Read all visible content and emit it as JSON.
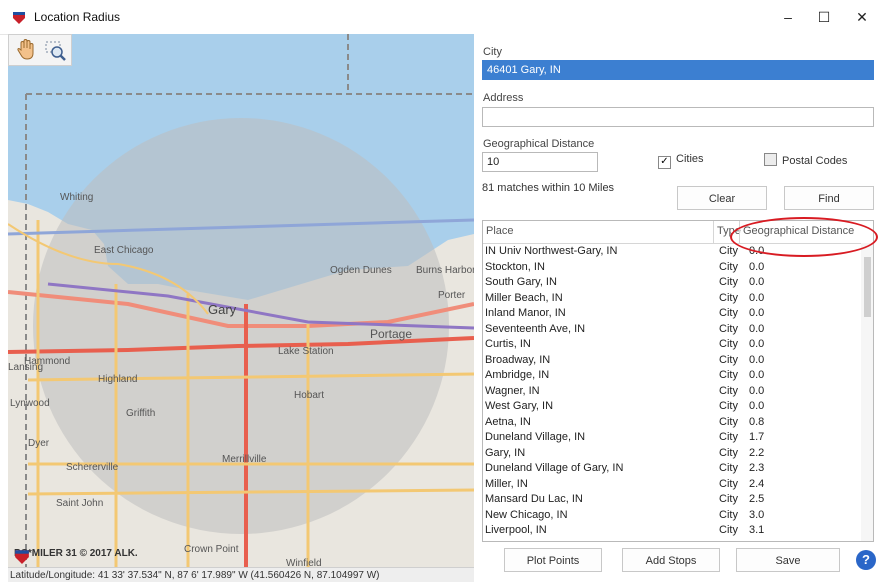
{
  "window": {
    "title": "Location Radius"
  },
  "map": {
    "brand": "PC*MILER 31 © 2017 ALK.",
    "latlon": "Latitude/Longitude: 41 33' 37.534\" N,  87  6' 17.989\" W (41.560426 N, 87.104997 W)",
    "labels": [
      "Whiting",
      "East Chicago",
      "Ogden Dunes",
      "Burns Harbor",
      "Porter",
      "Gary",
      "Portage",
      "Lake Station",
      "Hammond",
      "Highland",
      "Hobart",
      "Lynwood",
      "Griffith",
      "Lansing",
      "Dyer",
      "Schererville",
      "Merrillville",
      "Saint John",
      "Crown Point",
      "Winfield"
    ],
    "colors": {
      "water": "#a9cfeb",
      "land": "#e9e6df",
      "radius": "#bdbdbd"
    }
  },
  "form": {
    "city_label": "City",
    "city_value": "46401 Gary, IN",
    "address_label": "Address",
    "address_value": "",
    "distance_label": "Geographical Distance",
    "distance_value": "10",
    "cities_label": "Cities",
    "cities_checked": true,
    "postal_label": "Postal Codes",
    "postal_checked": false,
    "matches_text": "81 matches within 10 Miles",
    "clear_label": "Clear",
    "find_label": "Find"
  },
  "results": {
    "headers": {
      "place": "Place",
      "type": "Type",
      "distance": "Geographical Distance"
    },
    "rows": [
      {
        "place": "IN Univ Northwest-Gary, IN",
        "type": "City",
        "distance": "0.0"
      },
      {
        "place": "Stockton, IN",
        "type": "City",
        "distance": "0.0"
      },
      {
        "place": "South Gary, IN",
        "type": "City",
        "distance": "0.0"
      },
      {
        "place": "Miller Beach, IN",
        "type": "City",
        "distance": "0.0"
      },
      {
        "place": "Inland Manor, IN",
        "type": "City",
        "distance": "0.0"
      },
      {
        "place": "Seventeenth Ave, IN",
        "type": "City",
        "distance": "0.0"
      },
      {
        "place": "Curtis, IN",
        "type": "City",
        "distance": "0.0"
      },
      {
        "place": "Broadway, IN",
        "type": "City",
        "distance": "0.0"
      },
      {
        "place": "Ambridge, IN",
        "type": "City",
        "distance": "0.0"
      },
      {
        "place": "Wagner, IN",
        "type": "City",
        "distance": "0.0"
      },
      {
        "place": "West Gary, IN",
        "type": "City",
        "distance": "0.0"
      },
      {
        "place": "Aetna, IN",
        "type": "City",
        "distance": "0.8"
      },
      {
        "place": "Duneland Village, IN",
        "type": "City",
        "distance": "1.7"
      },
      {
        "place": "Gary, IN",
        "type": "City",
        "distance": "2.2"
      },
      {
        "place": "Duneland Village of Gary, IN",
        "type": "City",
        "distance": "2.3"
      },
      {
        "place": "Miller, IN",
        "type": "City",
        "distance": "2.4"
      },
      {
        "place": "Mansard Du Lac, IN",
        "type": "City",
        "distance": "2.5"
      },
      {
        "place": "New Chicago, IN",
        "type": "City",
        "distance": "3.0"
      },
      {
        "place": "Liverpool, IN",
        "type": "City",
        "distance": "3.1"
      }
    ]
  },
  "footer": {
    "plot_label": "Plot Points",
    "stops_label": "Add Stops",
    "save_label": "Save",
    "help_label": "?"
  }
}
